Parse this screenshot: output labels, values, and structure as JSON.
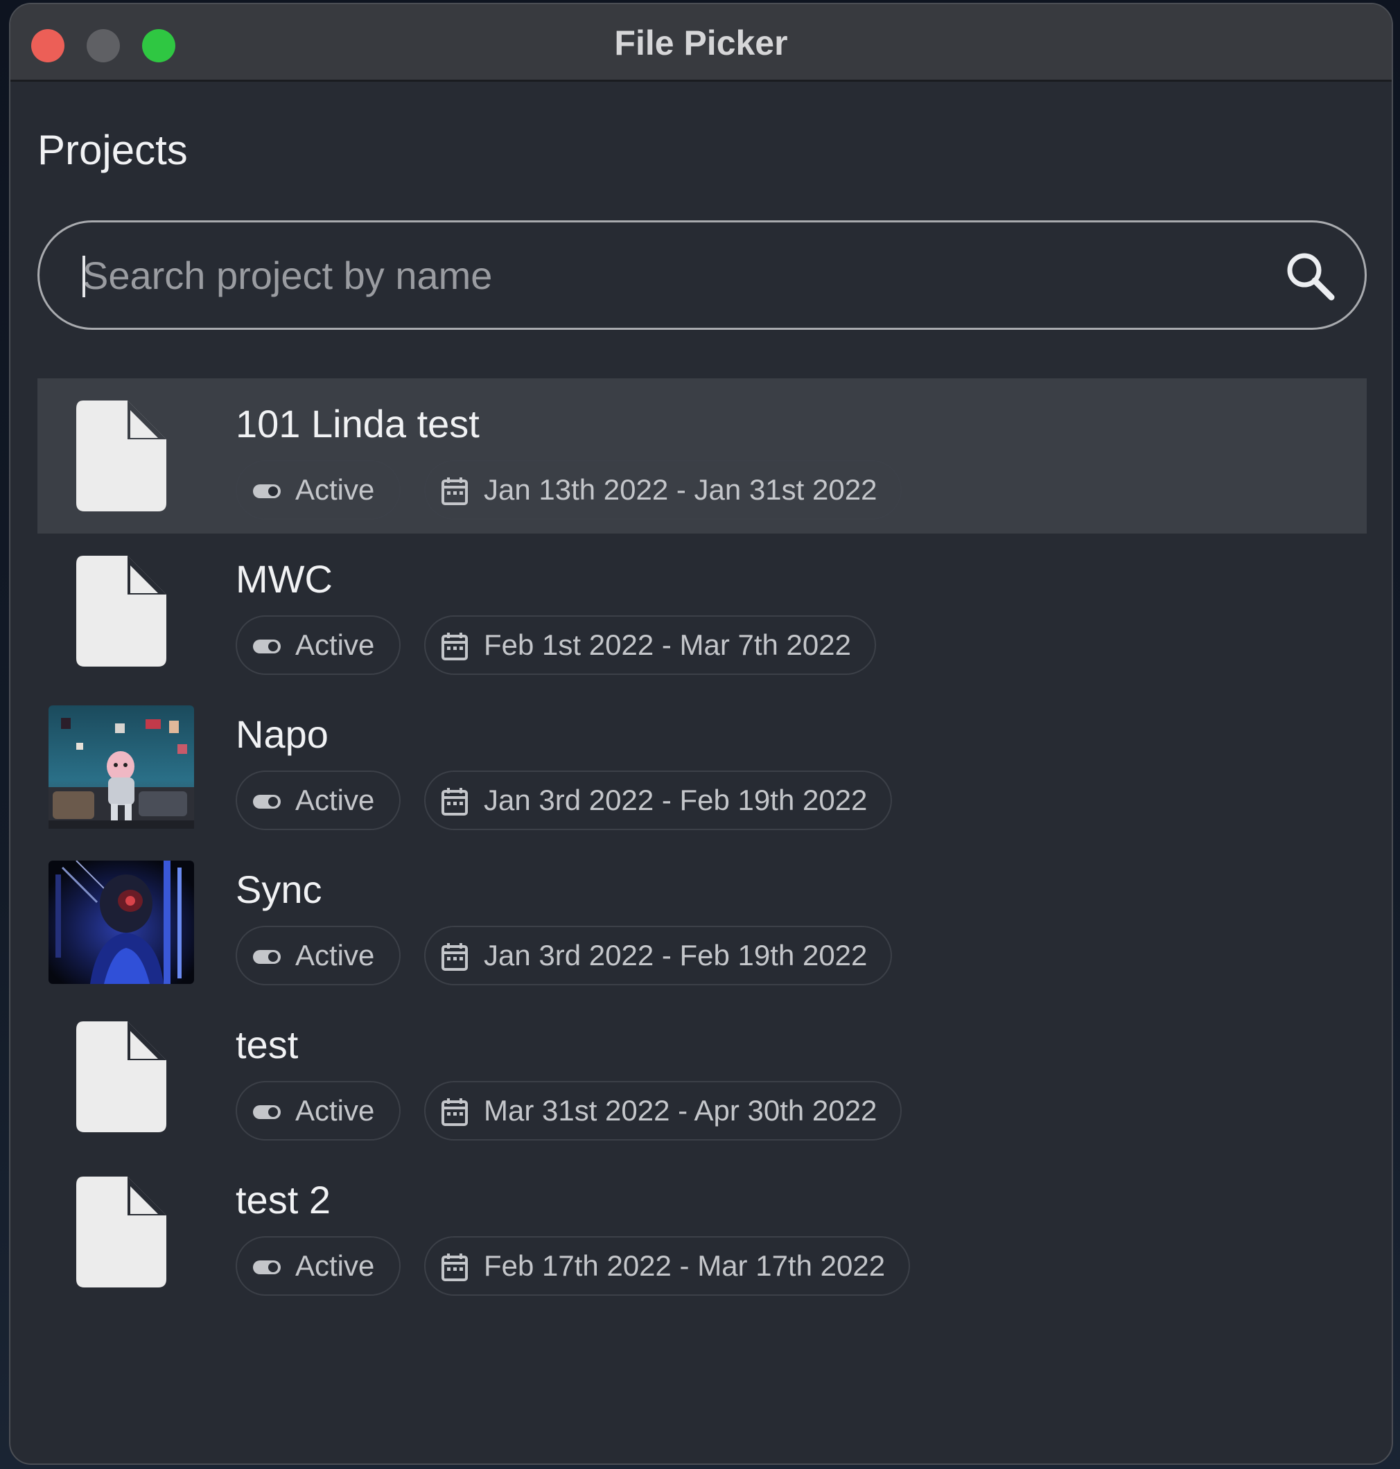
{
  "window": {
    "title": "File Picker"
  },
  "page": {
    "heading": "Projects"
  },
  "search": {
    "placeholder": "Search project by name",
    "value": "",
    "icon": "search-icon"
  },
  "projects": [
    {
      "name": "101 Linda test",
      "status": "Active",
      "dates": "Jan 13th 2022 - Jan 31st 2022",
      "thumbnail": "document-icon",
      "selected": true
    },
    {
      "name": "MWC",
      "status": "Active",
      "dates": "Feb 1st 2022 - Mar 7th 2022",
      "thumbnail": "document-icon",
      "selected": false
    },
    {
      "name": "Napo",
      "status": "Active",
      "dates": "Jan 3rd 2022 - Feb 19th 2022",
      "thumbnail": "image-thumbnail",
      "selected": false
    },
    {
      "name": "Sync",
      "status": "Active",
      "dates": "Jan 3rd 2022 - Feb 19th 2022",
      "thumbnail": "image-thumbnail",
      "selected": false
    },
    {
      "name": "test",
      "status": "Active",
      "dates": "Mar 31st 2022 - Apr 30th 2022",
      "thumbnail": "document-icon",
      "selected": false
    },
    {
      "name": "test 2",
      "status": "Active",
      "dates": "Feb 17th 2022 - Mar 17th 2022",
      "thumbnail": "document-icon",
      "selected": false
    }
  ],
  "colors": {
    "window_bg": "#272b33",
    "titlebar_bg": "#383a3f",
    "selected_row": "#3b3f46",
    "close": "#ec5f57",
    "minimize": "#5f6064",
    "maximize": "#2fc742"
  }
}
